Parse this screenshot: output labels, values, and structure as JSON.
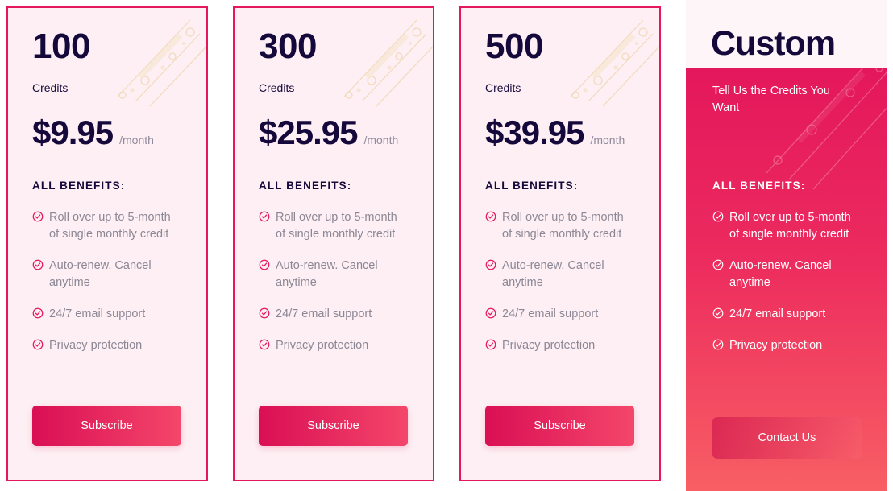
{
  "colors": {
    "card_border": "#e4175c",
    "card_background": "#fdeff3",
    "accent": "#e4175c",
    "accent_light": "#f4466a",
    "heading_text": "#15093b",
    "body_text": "#8c8795",
    "period_text": "#8f8a9b",
    "custom_text": "#ffffff",
    "page_background": "#ffffff"
  },
  "plans": [
    {
      "credits_number": "100",
      "credits_label": "Credits",
      "price_amount": "$9.95",
      "price_period": "/month",
      "benefits_title": "ALL BENEFITS:",
      "benefits": [
        "Roll over up to 5-month of single monthly credit",
        "Auto-renew. Cancel anytime",
        "24/7 email support",
        "Privacy protection"
      ],
      "cta_label": "Subscribe"
    },
    {
      "credits_number": "300",
      "credits_label": "Credits",
      "price_amount": "$25.95",
      "price_period": "/month",
      "benefits_title": "ALL BENEFITS:",
      "benefits": [
        "Roll over up to 5-month of single monthly credit",
        "Auto-renew. Cancel anytime",
        "24/7 email support",
        "Privacy protection"
      ],
      "cta_label": "Subscribe"
    },
    {
      "credits_number": "500",
      "credits_label": "Credits",
      "price_amount": "$39.95",
      "price_period": "/month",
      "benefits_title": "ALL BENEFITS:",
      "benefits": [
        "Roll over up to 5-month of single monthly credit",
        "Auto-renew. Cancel anytime",
        "24/7 email support",
        "Privacy protection"
      ],
      "cta_label": "Subscribe"
    }
  ],
  "custom_plan": {
    "title": "Custom",
    "subtitle": "Tell Us the Credits You Want",
    "benefits_title": "ALL BENEFITS:",
    "benefits": [
      "Roll over up to 5-month of single monthly credit",
      "Auto-renew. Cancel anytime",
      "24/7 email support",
      "Privacy protection"
    ],
    "cta_label": "Contact Us"
  },
  "icons": {
    "benefit_check": "check-circle-icon"
  }
}
